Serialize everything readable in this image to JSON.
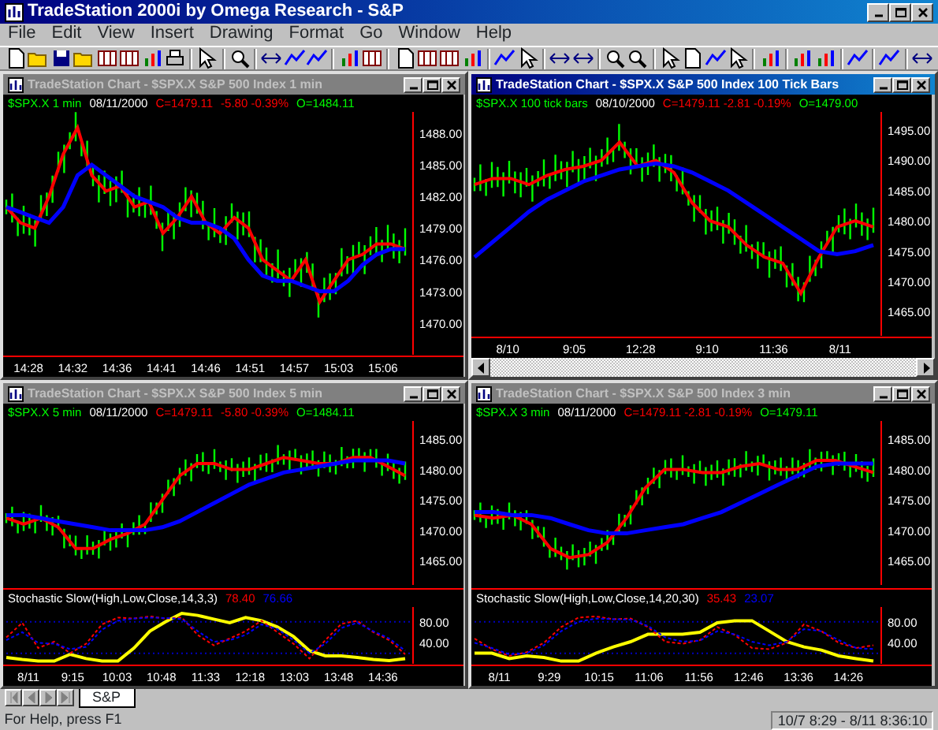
{
  "app": {
    "title": "TradeStation 2000i by Omega Research - S&P"
  },
  "menu": [
    "File",
    "Edit",
    "View",
    "Insert",
    "Drawing",
    "Format",
    "Go",
    "Window",
    "Help"
  ],
  "windows": [
    {
      "title": "TradeStation Chart - $SPX.X S&P 500 Index 1 min",
      "active": false,
      "scrollbar": false,
      "panes": [
        {
          "kind": "price",
          "legend": [
            {
              "text": "$SPX.X 1 min",
              "color": "#00ff00"
            },
            {
              "text": "08/11/2000",
              "color": "#ffffff"
            },
            {
              "text": "C=1479.11",
              "color": "#ff0000"
            },
            {
              "text": "-5.80 -0.39%",
              "color": "#ff0000"
            },
            {
              "text": "O=1484.11",
              "color": "#00ff00"
            }
          ],
          "time_labels": [
            "14:28",
            "14:32",
            "14:36",
            "14:41",
            "14:46",
            "14:51",
            "14:57",
            "15:03",
            "15:06"
          ],
          "chart_data": {
            "type": "line",
            "series": [
              {
                "color": "#ff0000",
                "values": [
                  1481,
                  1479.5,
                  1479,
                  1482,
                  1486,
                  1488.5,
                  1484,
                  1482.5,
                  1483,
                  1481,
                  1481.5,
                  1478.5,
                  1480,
                  1482,
                  1479.5,
                  1478.5,
                  1480,
                  1479,
                  1476,
                  1475,
                  1474,
                  1476,
                  1472,
                  1474,
                  1476,
                  1476.5,
                  1477.5,
                  1477.5,
                  1477
                ]
              },
              {
                "color": "#0000ff",
                "values": [
                  1481,
                  1480.5,
                  1480,
                  1479.5,
                  1481,
                  1484,
                  1485,
                  1484,
                  1483,
                  1482,
                  1481.5,
                  1481,
                  1480,
                  1479.5,
                  1479.5,
                  1479,
                  1478,
                  1476,
                  1474.5,
                  1474,
                  1474,
                  1473.5,
                  1473,
                  1473,
                  1474,
                  1475.5,
                  1476.5,
                  1477,
                  1477
                ]
              }
            ],
            "ylim": [
              1467,
              1490
            ],
            "yticks": [
              {
                "value": 1488,
                "label": "1488.00"
              },
              {
                "value": 1485,
                "label": "1485.00"
              },
              {
                "value": 1482,
                "label": "1482.00"
              },
              {
                "value": 1479,
                "label": "1479.00"
              },
              {
                "value": 1476,
                "label": "1476.00"
              },
              {
                "value": 1473,
                "label": "1473.00"
              },
              {
                "value": 1470,
                "label": "1470.00"
              }
            ]
          }
        }
      ]
    },
    {
      "title": "TradeStation Chart - $SPX.X S&P 500 Index 100 Tick Bars",
      "active": true,
      "scrollbar": true,
      "panes": [
        {
          "kind": "price",
          "legend": [
            {
              "text": "$SPX.X 100 tick bars",
              "color": "#00ff00"
            },
            {
              "text": "08/10/2000",
              "color": "#ffffff"
            },
            {
              "text": "C=1479.11 -2.81 -0.19%",
              "color": "#ff0000"
            },
            {
              "text": "O=1479.00",
              "color": "#00ff00"
            }
          ],
          "time_labels": [
            "8/10",
            "9:05",
            "12:28",
            "9:10",
            "11:36",
            "8/11"
          ],
          "chart_data": {
            "type": "line",
            "series": [
              {
                "color": "#ff0000",
                "values": [
                  1486,
                  1487,
                  1487,
                  1486,
                  1487.5,
                  1488.5,
                  1489,
                  1490,
                  1493,
                  1489,
                  1490,
                  1488,
                  1483,
                  1480,
                  1479,
                  1476,
                  1474,
                  1473,
                  1468,
                  1474,
                  1479,
                  1480,
                  1479
                ]
              },
              {
                "color": "#0000ff",
                "values": [
                  1474,
                  1476.5,
                  1479,
                  1481.5,
                  1483.5,
                  1485,
                  1486.5,
                  1487.5,
                  1488.5,
                  1489,
                  1489.5,
                  1489,
                  1488,
                  1486.5,
                  1485,
                  1483,
                  1481,
                  1479,
                  1477,
                  1475,
                  1474.5,
                  1475,
                  1476
                ]
              }
            ],
            "ylim": [
              1461,
              1498
            ],
            "yticks": [
              {
                "value": 1495,
                "label": "1495.00"
              },
              {
                "value": 1490,
                "label": "1490.00"
              },
              {
                "value": 1485,
                "label": "1485.00"
              },
              {
                "value": 1480,
                "label": "1480.00"
              },
              {
                "value": 1475,
                "label": "1475.00"
              },
              {
                "value": 1470,
                "label": "1470.00"
              },
              {
                "value": 1465,
                "label": "1465.00"
              }
            ]
          }
        }
      ]
    },
    {
      "title": "TradeStation Chart - $SPX.X S&P 500 Index 5 min",
      "active": false,
      "scrollbar": false,
      "panes": [
        {
          "kind": "price",
          "legend": [
            {
              "text": "$SPX.X 5 min",
              "color": "#00ff00"
            },
            {
              "text": "08/11/2000",
              "color": "#ffffff"
            },
            {
              "text": "C=1479.11",
              "color": "#ff0000"
            },
            {
              "text": "-5.80 -0.39%",
              "color": "#ff0000"
            },
            {
              "text": "O=1484.11",
              "color": "#00ff00"
            }
          ],
          "chart_data": {
            "type": "line",
            "series": [
              {
                "color": "#ff0000",
                "values": [
                  1472,
                  1471,
                  1472,
                  1470.5,
                  1467,
                  1467,
                  1468.5,
                  1469.5,
                  1471,
                  1475,
                  1479,
                  1481,
                  1481,
                  1480,
                  1480,
                  1481,
                  1482,
                  1481.5,
                  1481,
                  1481,
                  1482,
                  1482,
                  1480.5,
                  1479
                ]
              },
              {
                "color": "#0000ff",
                "values": [
                  1472.5,
                  1472.5,
                  1472,
                  1471.5,
                  1471,
                  1470.5,
                  1470,
                  1470,
                  1470,
                  1470.5,
                  1471.5,
                  1473,
                  1474.5,
                  1476,
                  1477.5,
                  1478.5,
                  1479.5,
                  1480,
                  1480.5,
                  1481,
                  1481.5,
                  1481.5,
                  1481.5,
                  1481
                ]
              }
            ],
            "ylim": [
              1461,
              1488
            ],
            "yticks": [
              {
                "value": 1485,
                "label": "1485.00"
              },
              {
                "value": 1480,
                "label": "1480.00"
              },
              {
                "value": 1475,
                "label": "1475.00"
              },
              {
                "value": 1470,
                "label": "1470.00"
              },
              {
                "value": 1465,
                "label": "1465.00"
              }
            ]
          }
        },
        {
          "kind": "oscillator",
          "legend": [
            {
              "text": "Stochastic Slow(High,Low,Close,14,3,3)",
              "color": "#ffffff"
            },
            {
              "text": "78.40",
              "color": "#ff0000"
            },
            {
              "text": "76.66",
              "color": "#0000ff"
            }
          ],
          "time_labels": [
            "8/11",
            "9:15",
            "10:03",
            "10:48",
            "11:33",
            "12:18",
            "13:03",
            "13:48",
            "14:36"
          ],
          "chart_data": {
            "type": "line",
            "series": [
              {
                "color": "#ffff00",
                "values": [
                  12,
                  8,
                  5,
                  5,
                  18,
                  10,
                  5,
                  5,
                  30,
                  62,
                  80,
                  96,
                  92,
                  85,
                  78,
                  88,
                  82,
                  70,
                  52,
                  25,
                  15,
                  15,
                  12,
                  8,
                  6,
                  10
                ]
              },
              {
                "color": "#ff0000",
                "line_style": "dashed",
                "values": [
                  50,
                  78,
                  30,
                  42,
                  20,
                  38,
                  75,
                  88,
                  86,
                  90,
                  86,
                  88,
                  55,
                  35,
                  48,
                  62,
                  82,
                  60,
                  38,
                  10,
                  45,
                  76,
                  82,
                  60,
                  45,
                  18
                ]
              },
              {
                "color": "#0000ff",
                "line_style": "dashed",
                "values": [
                  45,
                  60,
                  40,
                  38,
                  28,
                  32,
                  65,
                  82,
                  86,
                  88,
                  87,
                  85,
                  62,
                  42,
                  45,
                  55,
                  75,
                  66,
                  45,
                  20,
                  38,
                  68,
                  78,
                  62,
                  48,
                  25
                ]
              }
            ],
            "ylim": [
              0,
              108
            ],
            "yticks": [
              {
                "value": 80,
                "label": "80.00"
              },
              {
                "value": 40,
                "label": "40.00"
              }
            ],
            "ref_lines": [
              {
                "axis": "y",
                "value": 80
              },
              {
                "axis": "y",
                "value": 20
              }
            ]
          }
        }
      ]
    },
    {
      "title": "TradeStation Chart - $SPX.X S&P 500 Index 3 min",
      "active": false,
      "scrollbar": false,
      "panes": [
        {
          "kind": "price",
          "legend": [
            {
              "text": "$SPX.X 3 min",
              "color": "#00ff00"
            },
            {
              "text": "08/11/2000",
              "color": "#ffffff"
            },
            {
              "text": "C=1479.11 -2.81 -0.19%",
              "color": "#ff0000"
            },
            {
              "text": "O=1479.11",
              "color": "#00ff00"
            }
          ],
          "chart_data": {
            "type": "line",
            "series": [
              {
                "color": "#ff0000",
                "values": [
                  1472.5,
                  1472,
                  1472.5,
                  1471,
                  1467,
                  1465.5,
                  1466,
                  1468,
                  1472,
                  1477,
                  1480,
                  1480,
                  1479.5,
                  1479.5,
                  1480.5,
                  1481,
                  1480,
                  1480,
                  1481.5,
                  1481.5,
                  1480.5,
                  1479.5
                ]
              },
              {
                "color": "#0000ff",
                "values": [
                  1473,
                  1473,
                  1472.5,
                  1472.5,
                  1472,
                  1471,
                  1470,
                  1469.5,
                  1469.5,
                  1470,
                  1470.5,
                  1471,
                  1472,
                  1473,
                  1474.5,
                  1476,
                  1477.5,
                  1479,
                  1480.5,
                  1481,
                  1481,
                  1481
                ]
              }
            ],
            "ylim": [
              1461,
              1488
            ],
            "yticks": [
              {
                "value": 1485,
                "label": "1485.00"
              },
              {
                "value": 1480,
                "label": "1480.00"
              },
              {
                "value": 1475,
                "label": "1475.00"
              },
              {
                "value": 1470,
                "label": "1470.00"
              },
              {
                "value": 1465,
                "label": "1465.00"
              }
            ]
          }
        },
        {
          "kind": "oscillator",
          "legend": [
            {
              "text": "Stochastic Slow(High,Low,Close,14,20,30)",
              "color": "#ffffff"
            },
            {
              "text": "35.43",
              "color": "#ff0000"
            },
            {
              "text": "23.07",
              "color": "#0000ff"
            }
          ],
          "time_labels": [
            "8/11",
            "9:29",
            "10:15",
            "11:06",
            "11:56",
            "12:46",
            "13:36",
            "14:26"
          ],
          "chart_data": {
            "type": "line",
            "series": [
              {
                "color": "#ffff00",
                "values": [
                  20,
                  20,
                  10,
                  15,
                  12,
                  5,
                  5,
                  20,
                  32,
                  42,
                  56,
                  56,
                  56,
                  60,
                  78,
                  82,
                  82,
                  62,
                  42,
                  32,
                  26,
                  15,
                  10,
                  5
                ]
              },
              {
                "color": "#ff0000",
                "line_style": "dashed",
                "values": [
                  48,
                  28,
                  15,
                  22,
                  40,
                  70,
                  88,
                  90,
                  85,
                  86,
                  70,
                  42,
                  38,
                  45,
                  70,
                  55,
                  30,
                  28,
                  40,
                  75,
                  62,
                  40,
                  30,
                  35
                ]
              },
              {
                "color": "#0000ff",
                "line_style": "dashed",
                "values": [
                  40,
                  30,
                  18,
                  20,
                  35,
                  62,
                  80,
                  86,
                  85,
                  84,
                  72,
                  50,
                  42,
                  44,
                  62,
                  56,
                  42,
                  35,
                  42,
                  66,
                  62,
                  45,
                  30,
                  28
                ]
              }
            ],
            "ylim": [
              0,
              108
            ],
            "yticks": [
              {
                "value": 80,
                "label": "80.00"
              },
              {
                "value": 40,
                "label": "40.00"
              }
            ],
            "ref_lines": [
              {
                "axis": "y",
                "value": 80
              },
              {
                "axis": "y",
                "value": 20
              }
            ]
          }
        }
      ]
    }
  ],
  "sheet_tabs": [
    {
      "label": "S&P",
      "selected": true
    }
  ],
  "status_bar": {
    "text": "For Help, press F1",
    "datetime": "10/7 8:29 - 8/11 8:36:10"
  }
}
